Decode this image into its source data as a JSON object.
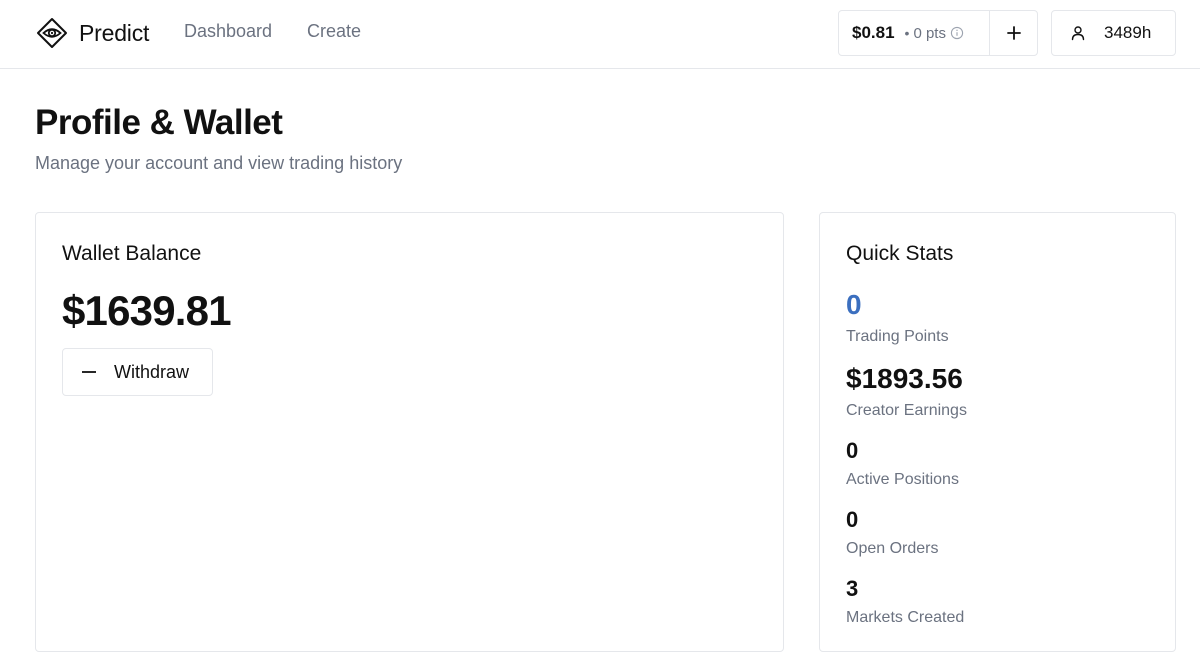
{
  "app": {
    "brand_name": "Predict",
    "brand_icon": "eye-diamond-icon"
  },
  "nav": {
    "dashboard_label": "Dashboard",
    "create_label": "Create"
  },
  "header": {
    "balance": "$0.81",
    "points": "0 pts",
    "user_label": "3489h"
  },
  "page": {
    "title": "Profile & Wallet",
    "subtitle": "Manage your account and view trading history"
  },
  "wallet": {
    "title": "Wallet Balance",
    "amount": "$1639.81",
    "withdraw_label": "Withdraw"
  },
  "stats": {
    "title": "Quick Stats",
    "items": [
      {
        "value": "0",
        "label": "Trading Points"
      },
      {
        "value": "$1893.56",
        "label": "Creator Earnings"
      },
      {
        "value": "0",
        "label": "Active Positions"
      },
      {
        "value": "0",
        "label": "Open Orders"
      },
      {
        "value": "3",
        "label": "Markets Created"
      }
    ]
  },
  "colors": {
    "accent": "#3b6fbf",
    "muted_text": "#6b7280",
    "border": "#e5e7eb"
  }
}
